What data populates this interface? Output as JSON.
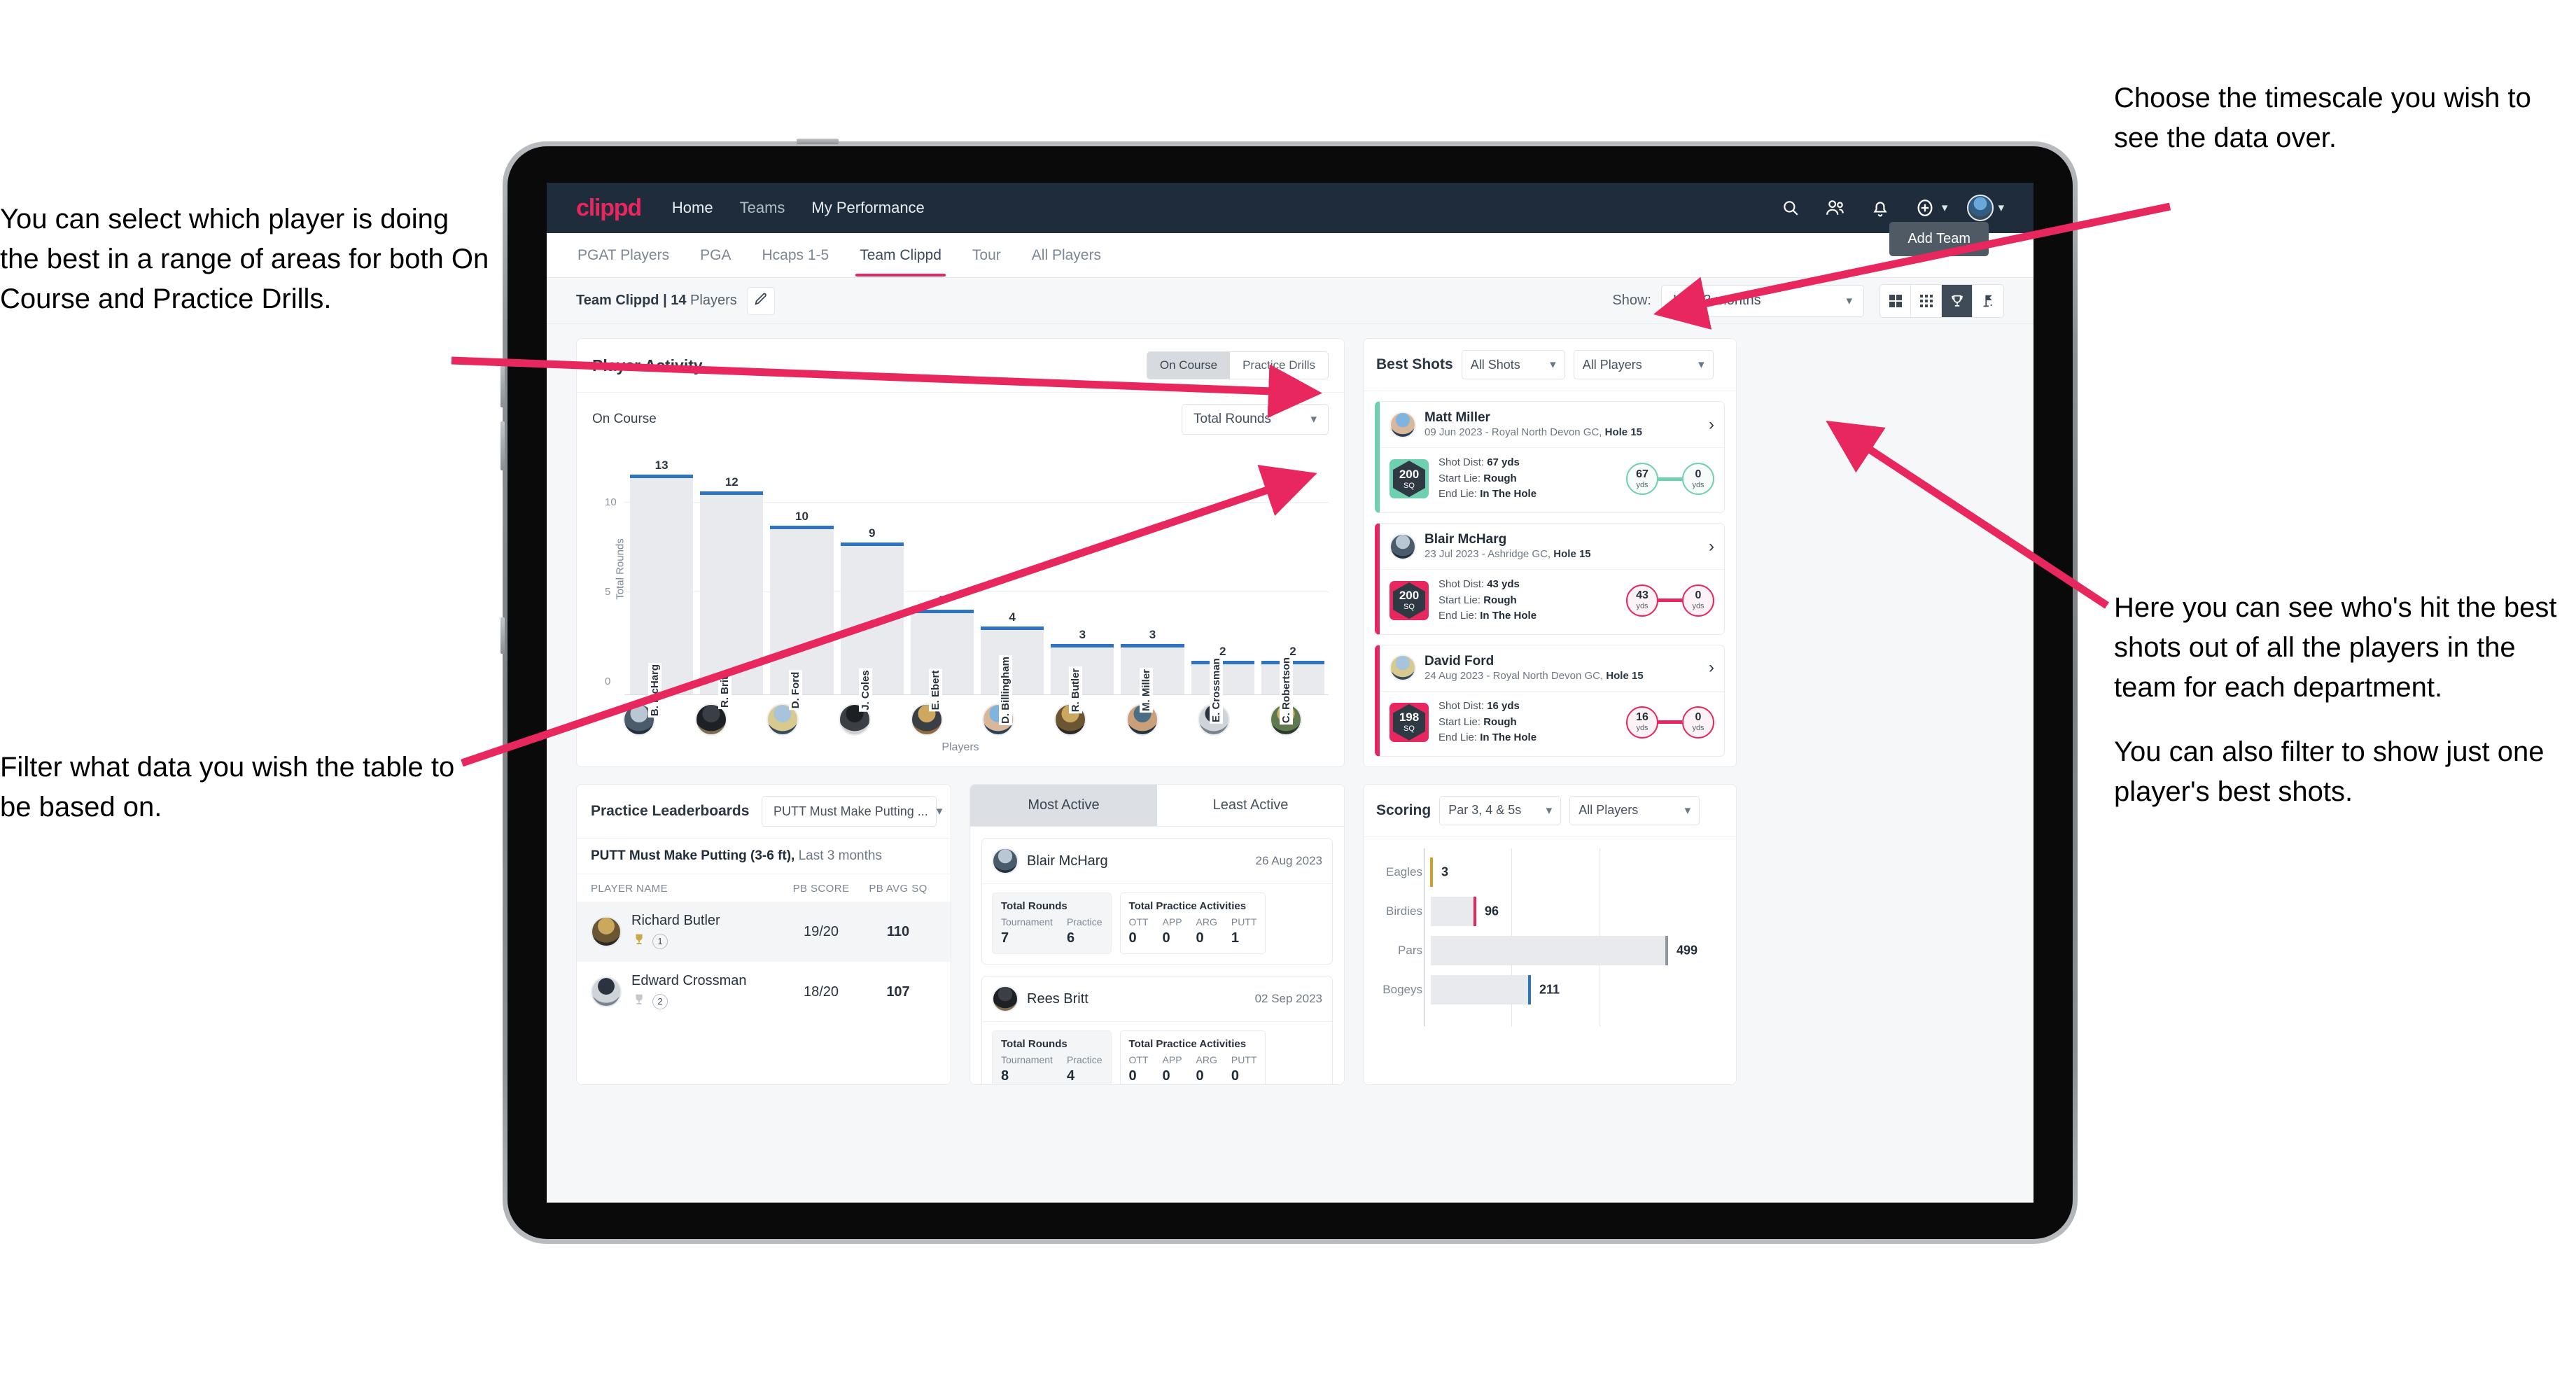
{
  "annotations": {
    "left_top": [
      "You can select which player is doing the best in a range of areas for both On Course and Practice Drills."
    ],
    "left_bottom": [
      "Filter what data you wish the table to be based on."
    ],
    "right_top": [
      "Choose the timescale you wish to see the data over."
    ],
    "right_mid": [
      "Here you can see who's hit the best shots out of all the players in the team for each department.",
      "You can also filter to show just one player's best shots."
    ]
  },
  "topnav": {
    "logo": "clippd",
    "links": [
      "Home",
      "Teams",
      "My Performance"
    ],
    "icons": [
      "search-icon",
      "people-icon",
      "bell-icon",
      "plus-circle-icon",
      "avatar-icon"
    ]
  },
  "tabs": {
    "items": [
      "PGAT Players",
      "PGA",
      "Hcaps 1-5",
      "Team Clippd",
      "Tour",
      "All Players"
    ],
    "active": "Team Clippd",
    "add_team_label": "Add Team"
  },
  "subbar": {
    "team_label_bold": "Team Clippd | 14",
    "team_label_rest": " Players",
    "edit_icon": "pencil-icon",
    "show_label": "Show:",
    "timescale": "Last 3 months",
    "view_icons": [
      "grid-large-icon",
      "grid-small-icon",
      "trophy-icon",
      "flag-icon"
    ],
    "view_active_index": 2
  },
  "player_activity": {
    "title": "Player Activity",
    "segments": [
      "On Course",
      "Practice Drills"
    ],
    "segment_active": "On Course",
    "sub_label": "On Course",
    "metric_select": "Total Rounds"
  },
  "chart_data": [
    {
      "type": "bar",
      "title": "Player Activity",
      "xlabel": "Players",
      "ylabel": "Total Rounds",
      "categories": [
        "B. McHarg",
        "R. Britt",
        "D. Ford",
        "J. Coles",
        "E. Ebert",
        "D. Billingham",
        "R. Butler",
        "M. Miller",
        "E. Crossman",
        "C. Robertson"
      ],
      "values": [
        13,
        12,
        10,
        9,
        5,
        4,
        3,
        3,
        2,
        2
      ],
      "ylim": [
        0,
        14
      ],
      "yticks": [
        0,
        5,
        10
      ],
      "grid": true,
      "bar_color": "#e8eaee",
      "cap_color": "#2f74c0"
    },
    {
      "type": "bar",
      "orientation": "horizontal",
      "title": "Scoring",
      "categories": [
        "Eagles",
        "Birdies",
        "Pars",
        "Bogeys"
      ],
      "values": [
        3,
        96,
        499,
        211
      ],
      "xlim": [
        0,
        560
      ],
      "cap_colors": [
        "#c9a227",
        "#e8275e",
        "#8d959d",
        "#2f74c0"
      ],
      "bar_color": "#e8eaee",
      "grid": true
    }
  ],
  "best_shots": {
    "title": "Best Shots",
    "filter_shots": "All Shots",
    "filter_players": "All Players",
    "cards": [
      {
        "name": "Matt Miller",
        "meta_prefix": "09 Jun 2023 - Royal North Devon GC, ",
        "meta_bold": "Hole 15",
        "sq_value": "200",
        "sq_unit": "SQ",
        "accent": "#6fd0b0",
        "shot_dist_label": "Shot Dist: ",
        "shot_dist": "67 yds",
        "start_lie_label": "Start Lie: ",
        "start_lie": "Rough",
        "end_lie_label": "End Lie: ",
        "end_lie": "In The Hole",
        "start_yds": "67",
        "end_yds": "0",
        "unit": "yds"
      },
      {
        "name": "Blair McHarg",
        "meta_prefix": "23 Jul 2023 - Ashridge GC, ",
        "meta_bold": "Hole 15",
        "sq_value": "200",
        "sq_unit": "SQ",
        "accent": "#e8275e",
        "shot_dist_label": "Shot Dist: ",
        "shot_dist": "43 yds",
        "start_lie_label": "Start Lie: ",
        "start_lie": "Rough",
        "end_lie_label": "End Lie: ",
        "end_lie": "In The Hole",
        "start_yds": "43",
        "end_yds": "0",
        "unit": "yds"
      },
      {
        "name": "David Ford",
        "meta_prefix": "24 Aug 2023 - Royal North Devon GC, ",
        "meta_bold": "Hole 15",
        "sq_value": "198",
        "sq_unit": "SQ",
        "accent": "#e8275e",
        "shot_dist_label": "Shot Dist: ",
        "shot_dist": "16 yds",
        "start_lie_label": "Start Lie: ",
        "start_lie": "Rough",
        "end_lie_label": "End Lie: ",
        "end_lie": "In The Hole",
        "start_yds": "16",
        "end_yds": "0",
        "unit": "yds"
      }
    ]
  },
  "practice_leaderboards": {
    "title": "Practice Leaderboards",
    "drill_select": "PUTT Must Make Putting ...",
    "subtitle_bold": "PUTT Must Make Putting (3-6 ft),",
    "subtitle_rest": " Last 3 months",
    "columns": [
      "PLAYER NAME",
      "PB SCORE",
      "PB AVG SQ"
    ],
    "rows": [
      {
        "name": "Richard Butler",
        "rank": "1",
        "trophy": "gold",
        "pb_score": "19/20",
        "pb_avg_sq": "110"
      },
      {
        "name": "Edward Crossman",
        "rank": "2",
        "trophy": "silver",
        "pb_score": "18/20",
        "pb_avg_sq": "107"
      }
    ]
  },
  "activity": {
    "tabs": [
      "Most Active",
      "Least Active"
    ],
    "active": "Most Active",
    "rounds_header": "Total Rounds",
    "rounds_keys": [
      "Tournament",
      "Practice"
    ],
    "practice_header": "Total Practice Activities",
    "practice_keys": [
      "OTT",
      "APP",
      "ARG",
      "PUTT"
    ],
    "cards": [
      {
        "name": "Blair McHarg",
        "date": "26 Aug 2023",
        "rounds": [
          "7",
          "6"
        ],
        "practice": [
          "0",
          "0",
          "0",
          "1"
        ]
      },
      {
        "name": "Rees Britt",
        "date": "02 Sep 2023",
        "rounds": [
          "8",
          "4"
        ],
        "practice": [
          "0",
          "0",
          "0",
          "0"
        ]
      }
    ]
  },
  "scoring": {
    "title": "Scoring",
    "filter_par": "Par 3, 4 & 5s",
    "filter_players": "All Players"
  }
}
